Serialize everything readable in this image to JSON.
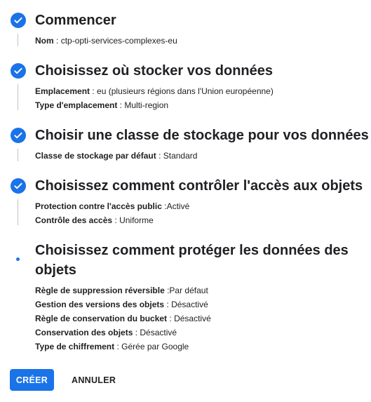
{
  "accent": "#1a73e8",
  "steps": [
    {
      "status": "done",
      "title": "Commencer",
      "rows": [
        {
          "label": "Nom",
          "sep": " : ",
          "value": "ctp-opti-services-complexes-eu"
        }
      ]
    },
    {
      "status": "done",
      "title": "Choisissez où stocker vos données",
      "rows": [
        {
          "label": "Emplacement",
          "sep": " : ",
          "value": "eu (plusieurs régions dans l'Union européenne)"
        },
        {
          "label": "Type d'emplacement",
          "sep": " : ",
          "value": "Multi-region"
        }
      ]
    },
    {
      "status": "done",
      "title": "Choisir une classe de stockage pour vos données",
      "rows": [
        {
          "label": "Classe de stockage par défaut",
          "sep": " : ",
          "value": "Standard"
        }
      ]
    },
    {
      "status": "done",
      "title": "Choisissez comment contrôler l'accès aux objets",
      "rows": [
        {
          "label": "Protection contre l'accès public",
          "sep": " :",
          "value": "Activé"
        },
        {
          "label": "Contrôle des accès",
          "sep": " : ",
          "value": "Uniforme"
        }
      ]
    },
    {
      "status": "current",
      "title_line1": "Choisissez comment protéger les données des",
      "title_line2": "objets",
      "rows": [
        {
          "label": "Règle de suppression réversible",
          "sep": " :",
          "value": "Par défaut"
        },
        {
          "label": "Gestion des versions des objets",
          "sep": " : ",
          "value": "Désactivé"
        },
        {
          "label": "Règle de conservation du bucket",
          "sep": " : ",
          "value": "Désactivé"
        },
        {
          "label": "Conservation des objets",
          "sep": " : ",
          "value": "Désactivé"
        },
        {
          "label": "Type de chiffrement",
          "sep": " : ",
          "value": "Gérée par Google"
        }
      ]
    }
  ],
  "buttons": {
    "create_label": "CRÉER",
    "cancel_label": "ANNULER"
  }
}
